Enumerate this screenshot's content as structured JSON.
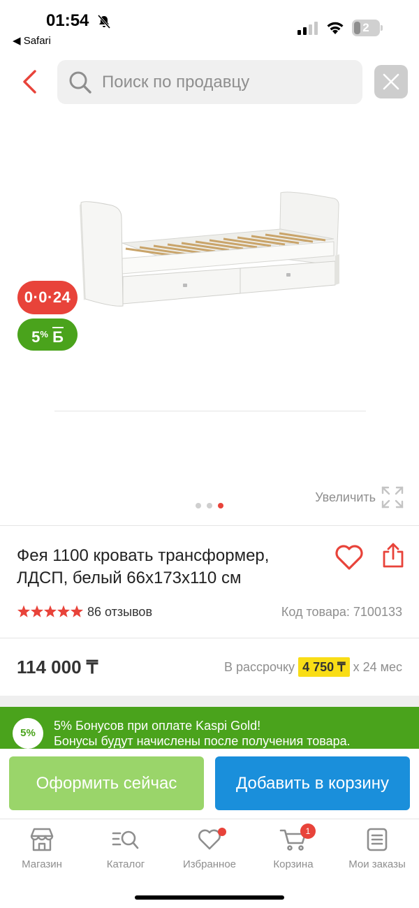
{
  "status_bar": {
    "time": "01:54",
    "back_app": "◀ Safari",
    "battery": "2"
  },
  "search": {
    "placeholder": "Поиск по продавцу"
  },
  "gallery": {
    "badge_installment": "0·0·24",
    "badge_bonus_percent": "5",
    "badge_bonus_sign": "%",
    "badge_bonus_currency": "Б",
    "zoom_label": "Увеличить",
    "image_count": 3,
    "active_image_index": 3
  },
  "product": {
    "title": "Фея 1100 кровать трансформер, ЛДСП, белый 66x173x110 см",
    "rating": 5,
    "reviews": "86 отзывов",
    "sku": "Код товара: 7100133",
    "price": "114 000 ₸",
    "installment_prefix": "В рассрочку",
    "installment_amount": "4 750 ₸",
    "installment_suffix": "x 24 мес"
  },
  "bonus_banner": {
    "circle": "5%",
    "line1": "5% Бонусов при оплате Kaspi Gold!",
    "line2": "Бонусы будут начислены после получения товара."
  },
  "actions": {
    "buy_now": "Оформить сейчас",
    "add_to_cart": "Добавить в корзину"
  },
  "tabbar": {
    "items": [
      {
        "label": "Магазин",
        "icon": "store-icon"
      },
      {
        "label": "Каталог",
        "icon": "catalog-search-icon"
      },
      {
        "label": "Избранное",
        "icon": "heart-icon"
      },
      {
        "label": "Корзина",
        "icon": "cart-icon"
      },
      {
        "label": "Мои заказы",
        "icon": "orders-icon"
      }
    ],
    "cart_count": "1"
  },
  "colors": {
    "accent_red": "#e8433a",
    "bonus_green": "#4aa31c",
    "buy_green": "#9ad56a",
    "cart_blue": "#1a8fdb",
    "installment_yellow": "#f9dd16"
  }
}
